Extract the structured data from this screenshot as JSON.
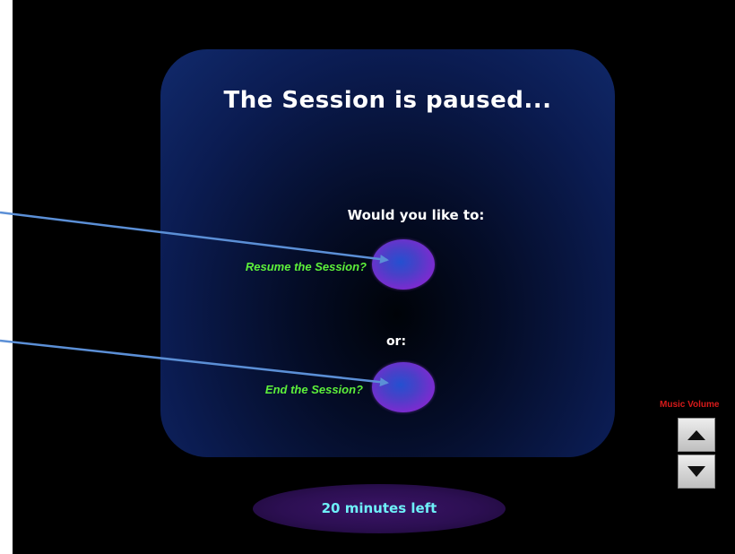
{
  "dialog": {
    "title": "The Session is paused...",
    "prompt": "Would you like to:",
    "or_text": "or:",
    "resume_label": "Resume the Session?",
    "end_label": "End the Session?"
  },
  "timer": {
    "text": "20 minutes left"
  },
  "volume": {
    "label": "Music Volume",
    "up_icon": "triangle-up-icon",
    "down_icon": "triangle-down-icon"
  },
  "colors": {
    "background": "#000000",
    "panel": "#0b1c52",
    "option_text": "#5df03a",
    "timer_text": "#6ef0f8",
    "volume_label": "#d81a1a",
    "orb": "#7a2ccf",
    "annotation_arrow": "#5b8fd6"
  }
}
